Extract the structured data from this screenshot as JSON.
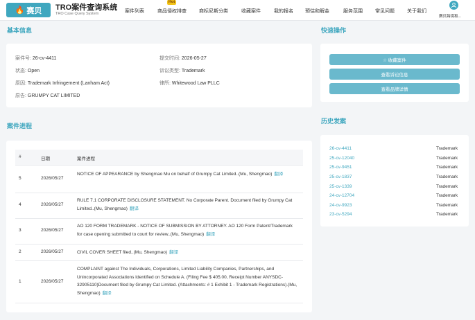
{
  "nav": {
    "logo_mark": "🔥",
    "logo_text": "赛贝",
    "brand_title": "TRO案件查询系统",
    "brand_subtitle": "TRO Case Query System",
    "menu": [
      "案件列表",
      "商品侵权排查",
      "商标尼斯分类",
      "收藏案件",
      "我的报名",
      "预估和解金",
      "服务范围",
      "常见问题",
      "关于我们"
    ],
    "hot_badge": "Hot",
    "user_name": "赛贝跨境和..."
  },
  "basic_info": {
    "title": "基本信息",
    "fields": [
      {
        "label": "案件号:",
        "value": "26-cv-4411"
      },
      {
        "label": "提交时间:",
        "value": "2026-05-27"
      },
      {
        "label": "状态:",
        "value": "Open"
      },
      {
        "label": "诉讼类型:",
        "value": "Trademark"
      },
      {
        "label": "原因:",
        "value": "Trademark Infringement (Lanham Act)"
      },
      {
        "label": "律所:",
        "value": "Whitewood Law PLLC"
      },
      {
        "label": "原告:",
        "value": "GRUMPY CAT LIMITED"
      }
    ]
  },
  "quick_actions": {
    "title": "快速操作",
    "buttons": [
      "☆ 收藏案件",
      "查看诉讼信息",
      "查看品牌详情"
    ]
  },
  "history": {
    "title": "历史发案",
    "cases": [
      {
        "case": "26-cv-4411",
        "type": "Trademark"
      },
      {
        "case": "25-cv-12040",
        "type": "Trademark"
      },
      {
        "case": "25-cv-9451",
        "type": "Trademark"
      },
      {
        "case": "25-cv-1837",
        "type": "Trademark"
      },
      {
        "case": "25-cv-1339",
        "type": "Trademark"
      },
      {
        "case": "24-cv-12704",
        "type": "Trademark"
      },
      {
        "case": "24-cv-9923",
        "type": "Trademark"
      },
      {
        "case": "23-cv-5294",
        "type": "Trademark"
      }
    ]
  },
  "progress": {
    "title": "案件进程",
    "headers": [
      "#",
      "日期",
      "案件进程"
    ],
    "translate_label": "翻译",
    "rows": [
      {
        "num": "5",
        "date": "2026/05/27",
        "text": "NOTICE OF APPEARANCE by Shengmao Mu on behalf of Grumpy Cat Limited..(Mu, Shengmao)"
      },
      {
        "num": "4",
        "date": "2026/05/27",
        "text": "RULE 7.1 CORPORATE DISCLOSURE STATEMENT. No Corporate Parent. Document filed by Grumpy Cat Limited..(Mu, Shengmao)"
      },
      {
        "num": "3",
        "date": "2026/05/27",
        "text": "AO 120 FORM TRADEMARK - NOTICE OF SUBMISSION BY ATTORNEY. AO 120 Form Patent/Trademark for case opening submitted to court for review..(Mu, Shengmao)"
      },
      {
        "num": "2",
        "date": "2026/05/27",
        "text": "CIVIL COVER SHEET filed..(Mu, Shengmao)"
      },
      {
        "num": "1",
        "date": "2026/05/27",
        "text": "COMPLAINT against The Individuals, Corporations, Limited Liability Companies, Partnerships, and Unincorporated Associations Identified on Schedule A. (Filing Fee $ 405.00, Receipt Number ANYSDC-32905110)Document filed by Grumpy Cat Limited. (Attachments: # 1 Exhibit 1 - Trademark Registrations).(Mu, Shengmao)"
      }
    ]
  }
}
